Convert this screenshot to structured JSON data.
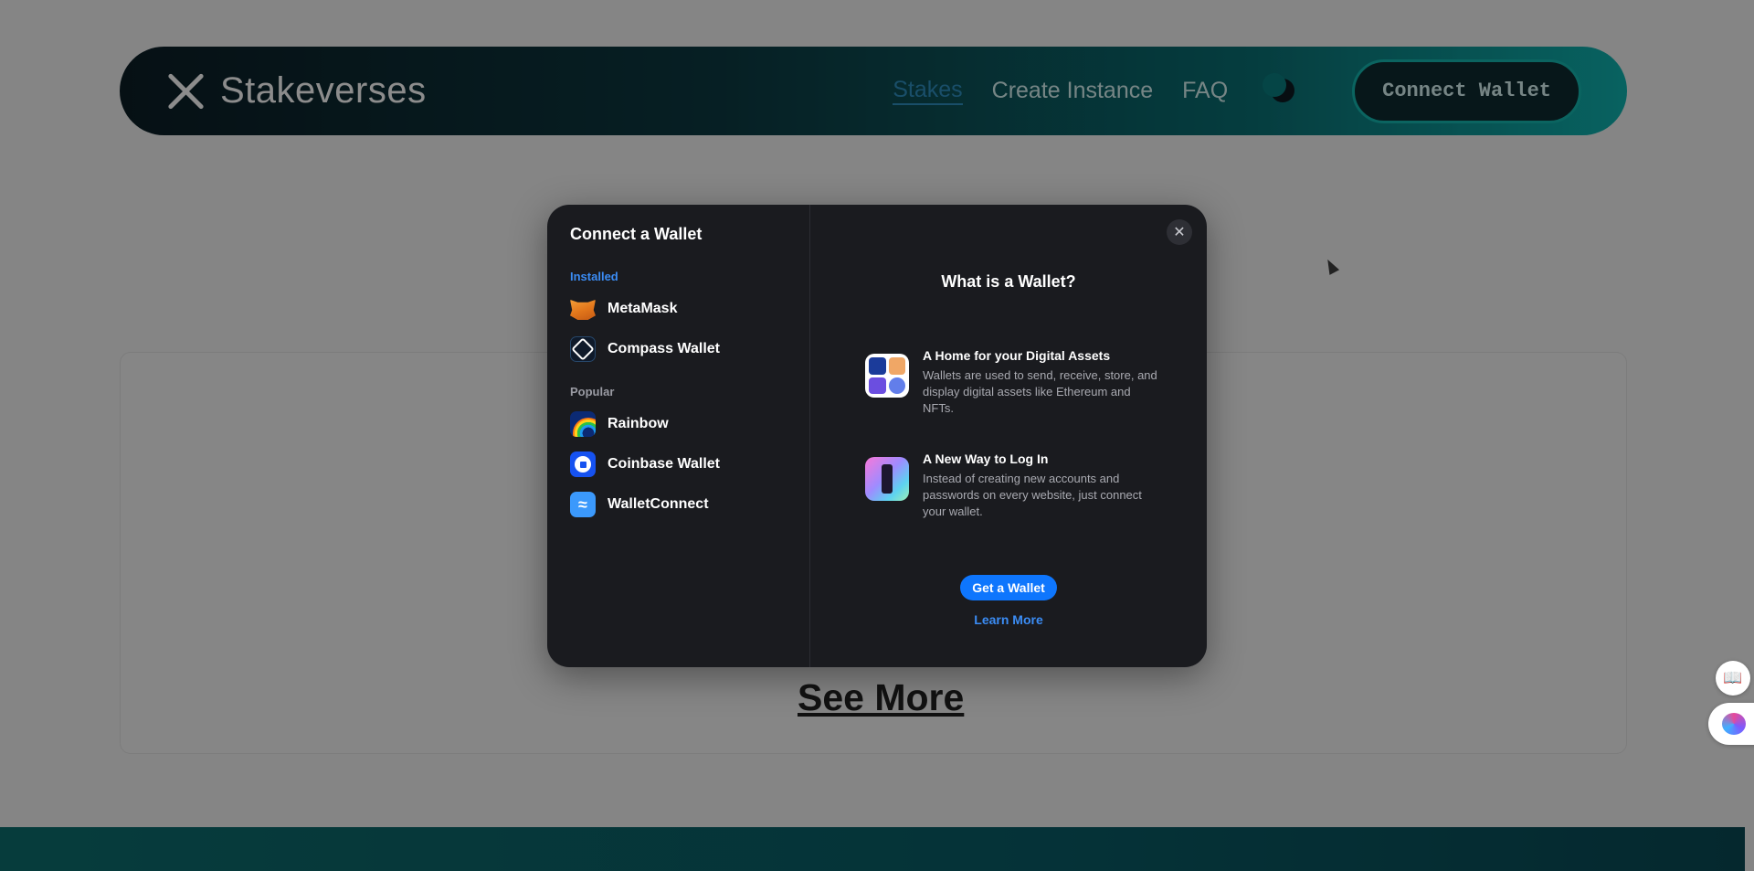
{
  "navbar": {
    "brand": "Stakeverses",
    "links": [
      "Stakes",
      "Create Instance",
      "FAQ"
    ],
    "connect_label": "Connect Wallet"
  },
  "page": {
    "see_more": "See More"
  },
  "modal": {
    "title": "Connect a Wallet",
    "installed_label": "Installed",
    "popular_label": "Popular",
    "installed": [
      {
        "name": "MetaMask",
        "icon": "metamask-icon"
      },
      {
        "name": "Compass Wallet",
        "icon": "compass-icon"
      }
    ],
    "popular": [
      {
        "name": "Rainbow",
        "icon": "rainbow-icon"
      },
      {
        "name": "Coinbase Wallet",
        "icon": "coinbase-icon"
      },
      {
        "name": "WalletConnect",
        "icon": "walletconnect-icon"
      }
    ],
    "close_icon": "close-icon",
    "info": {
      "title": "What is a Wallet?",
      "blocks": [
        {
          "heading": "A Home for your Digital Assets",
          "text": "Wallets are used to send, receive, store, and display digital assets like Ethereum and NFTs."
        },
        {
          "heading": "A New Way to Log In",
          "text": "Instead of creating new accounts and passwords on every website, just connect your wallet."
        }
      ],
      "get_wallet": "Get a Wallet",
      "learn_more": "Learn More"
    }
  },
  "colors": {
    "accent": "#0e76fd",
    "installed_label": "#3b8cf4",
    "modal_bg": "#1a1b1f"
  }
}
